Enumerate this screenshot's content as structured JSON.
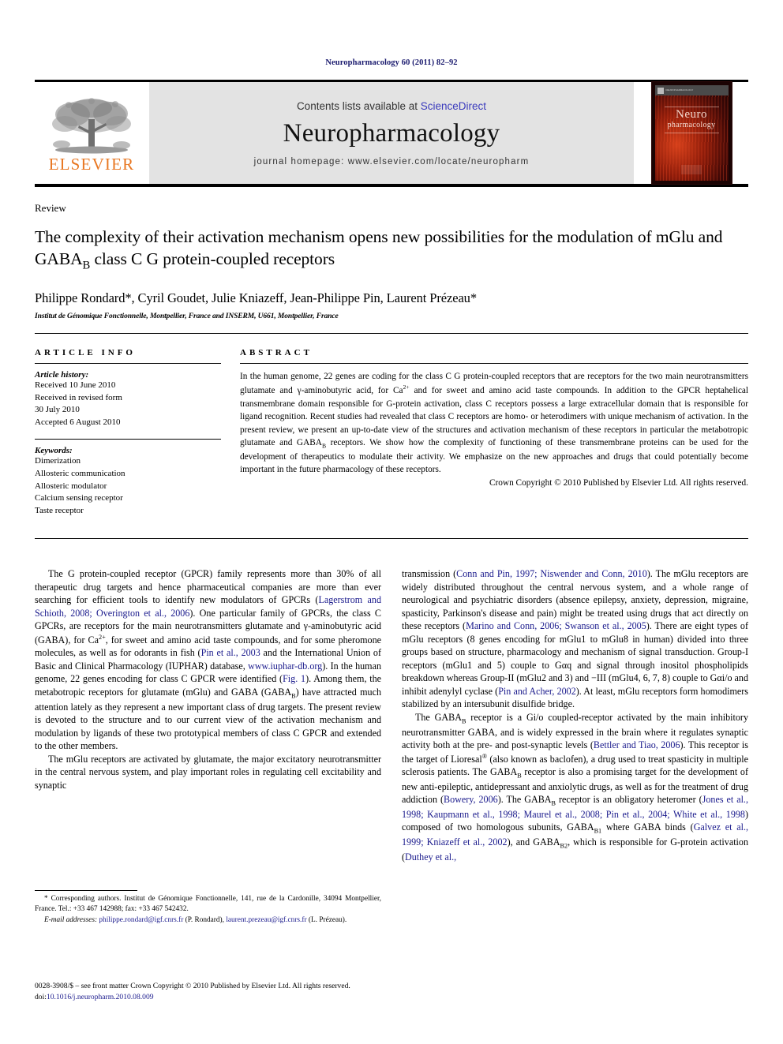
{
  "running_head": "Neuropharmacology 60 (2011) 82–92",
  "masthead": {
    "publisher_name": "ELSEVIER",
    "contents_prefix": "Contents lists available at ",
    "contents_link": "ScienceDirect",
    "journal_name": "Neuropharmacology",
    "homepage": "journal homepage: www.elsevier.com/locate/neuropharm",
    "cover": {
      "title_line1": "Neuro",
      "title_line2": "pharmacology"
    }
  },
  "article": {
    "type_label": "Review",
    "title_part1": "The complexity of their activation mechanism opens new possibilities for the modulation of mGlu and GABA",
    "title_sub": "B",
    "title_part2": " class C G protein-coupled receptors",
    "authors": "Philippe Rondard*, Cyril Goudet, Julie Kniazeff, Jean-Philippe Pin, Laurent Prézeau*",
    "affiliation": "Institut de Génomique Fonctionnelle, Montpellier, France and INSERM, U661, Montpellier, France"
  },
  "article_info": {
    "heading": "ARTICLE INFO",
    "history_label": "Article history:",
    "history_lines": [
      "Received 10 June 2010",
      "Received in revised form",
      "30 July 2010",
      "Accepted 6 August 2010"
    ],
    "keywords_label": "Keywords:",
    "keywords": [
      "Dimerization",
      "Allosteric communication",
      "Allosteric modulator",
      "Calcium sensing receptor",
      "Taste receptor"
    ]
  },
  "abstract": {
    "heading": "ABSTRACT",
    "p1_a": "In the human genome, 22 genes are coding for the class C G protein-coupled receptors that are receptors for the two main neurotransmitters glutamate and γ-aminobutyric acid, for Ca",
    "p1_sup": "2+",
    "p1_b": " and for sweet and amino acid taste compounds. In addition to the GPCR heptahelical transmembrane domain responsible for G-protein activation, class C receptors possess a large extracellular domain that is responsible for ligand recognition. Recent studies had revealed that class C receptors are homo- or heterodimers with unique mechanism of activation. In the present review, we present an up-to-date view of the structures and activation mechanism of these receptors in particular the metabotropic glutamate and GABA",
    "p1_sub": "B",
    "p1_c": " receptors. We show how the complexity of functioning of these transmembrane proteins can be used for the development of therapeutics to modulate their activity. We emphasize on the new approaches and drugs that could potentially become important in the future pharmacology of these receptors.",
    "copyright": "Crown Copyright © 2010 Published by Elsevier Ltd. All rights reserved."
  },
  "body": {
    "left": {
      "p1_t1": "The G protein-coupled receptor (GPCR) family represents more than 30% of all therapeutic drug targets and hence pharmaceutical companies are more than ever searching for efficient tools to identify new modulators of GPCRs (",
      "p1_r1": "Lagerstrom and Schioth, 2008; Overington et al., 2006",
      "p1_t2": "). One particular family of GPCRs, the class C GPCRs, are receptors for the main neurotransmitters glutamate and γ-aminobutyric acid (GABA), for Ca",
      "p1_sup": "2+",
      "p1_t3": ", for sweet and amino acid taste compounds, and for some pheromone molecules, as well as for odorants in fish (",
      "p1_r2": "Pin et al., 2003",
      "p1_t4": " and the International Union of Basic and Clinical Pharmacology (IUPHAR) database, ",
      "p1_r3": "www.iuphar-db.org",
      "p1_t5": "). In the human genome, 22 genes encoding for class C GPCR were identified (",
      "p1_r4": "Fig. 1",
      "p1_t6": "). Among them, the metabotropic receptors for glutamate (mGlu) and GABA (GABA",
      "p1_sub": "B",
      "p1_t7": ") have attracted much attention lately as they represent a new important class of drug targets. The present review is devoted to the structure and to our current view of the activation mechanism and modulation by ligands of these two prototypical members of class C GPCR and extended to the other members.",
      "p2": "The mGlu receptors are activated by glutamate, the major excitatory neurotransmitter in the central nervous system, and play important roles in regulating cell excitability and synaptic"
    },
    "right": {
      "p1_t1": "transmission (",
      "p1_r1": "Conn and Pin, 1997; Niswender and Conn, 2010",
      "p1_t2": "). The mGlu receptors are widely distributed throughout the central nervous system, and a whole range of neurological and psychiatric disorders (absence epilepsy, anxiety, depression, migraine, spasticity, Parkinson's disease and pain) might be treated using drugs that act directly on these receptors (",
      "p1_r2": "Marino and Conn, 2006; Swanson et al., 2005",
      "p1_t3": "). There are eight types of mGlu receptors (8 genes encoding for mGlu1 to mGlu8 in human) divided into three groups based on structure, pharmacology and mechanism of signal transduction. Group-I receptors (mGlu1 and 5) couple to Gαq and signal through inositol phospholipids breakdown whereas Group-II (mGlu2 and 3) and −III (mGlu4, 6, 7, 8) couple to Gαi/o and inhibit adenylyl cyclase (",
      "p1_r3": "Pin and Acher, 2002",
      "p1_t4": "). At least, mGlu receptors form homodimers stabilized by an intersubunit disulfide bridge.",
      "p2_t1": "The GABA",
      "p2_sub1": "B",
      "p2_t2": " receptor is a Gi/o coupled-receptor activated by the main inhibitory neurotransmitter GABA, and is widely expressed in the brain where it regulates synaptic activity both at the pre- and post-synaptic levels (",
      "p2_r1": "Bettler and Tiao, 2006",
      "p2_t3": "). This receptor is the target of Lioresal",
      "p2_sup": "®",
      "p2_t4": " (also known as baclofen), a drug used to treat spasticity in multiple sclerosis patients. The GABA",
      "p2_sub2": "B",
      "p2_t5": " receptor is also a promising target for the development of new anti-epileptic, antidepressant and anxiolytic drugs, as well as for the treatment of drug addiction (",
      "p2_r2": "Bowery, 2006",
      "p2_t6": "). The GABA",
      "p2_sub3": "B",
      "p2_t7": " receptor is an obligatory heteromer (",
      "p2_r3": "Jones et al., 1998; Kaupmann et al., 1998; Maurel et al., 2008; Pin et al., 2004; White et al., 1998",
      "p2_t8": ") composed of two homologous subunits, GABA",
      "p2_sub4": "B1",
      "p2_t9": " where GABA binds (",
      "p2_r4": "Galvez et al., 1999; Kniazeff et al., 2002",
      "p2_t10": "), and GABA",
      "p2_sub5": "B2",
      "p2_t11": ", which is responsible for G-protein activation (",
      "p2_r5": "Duthey et al.,"
    }
  },
  "footnote": {
    "line1": "* Corresponding authors. Institut de Génomique Fonctionnelle, 141, rue de la Cardonille, 34094 Montpellier, France. Tel.: +33 467 142988; fax: +33 467 542432.",
    "email_label": "E-mail addresses:",
    "email1": "philippe.rondard@igf.cnrs.fr",
    "email1_name": " (P. Rondard), ",
    "email2": "laurent.prezeau@igf.cnrs.fr",
    "email2_name": " (L. Prézeau)."
  },
  "footer": {
    "issn_line": "0028-3908/$ – see front matter Crown Copyright © 2010 Published by Elsevier Ltd. All rights reserved.",
    "doi_prefix": "doi:",
    "doi": "10.1016/j.neuropharm.2010.08.009"
  },
  "colors": {
    "link": "#1a1a8c",
    "sciencedirect": "#3b3bbd",
    "elsevier_orange": "#E87722",
    "masthead_bg": "#e3e3e3"
  }
}
